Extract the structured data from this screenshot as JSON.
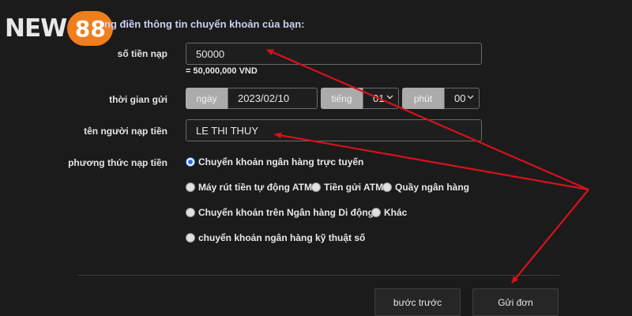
{
  "logo": {
    "part1": "NEW",
    "part2": "88"
  },
  "heading": "ng điền thông tin chuyển khoản của bạn:",
  "amount": {
    "label": "số tiền nạp",
    "value": "50000",
    "converted": "= 50,000,000 VND"
  },
  "time": {
    "label": "thời gian gửi",
    "day_label": "ngày",
    "day_value": "2023/02/10",
    "hour_label": "tiếng",
    "hour_value": "01",
    "minute_label": "phút",
    "minute_value": "00"
  },
  "name": {
    "label": "tên người nạp tiền",
    "value": "LE THI THUY"
  },
  "method": {
    "label": "phương thức nạp tiền",
    "options": [
      "Chuyển khoản ngân hàng trực tuyến",
      "Máy rút tiền tự động ATM",
      "Tiền gửi ATM",
      "Quầy ngân hàng",
      "Chuyển khoản trên Ngân hàng Di động",
      "Khác",
      "chuyển khoản ngân hàng kỹ thuật số"
    ],
    "selected": "Chuyển khoản ngân hàng trực tuyến"
  },
  "buttons": {
    "back": "bước trước",
    "submit": "Gửi đơn"
  },
  "colors": {
    "background": "#1b1b1b",
    "logo_accent": "#f07e1c",
    "arrow": "#d8111b",
    "radio_selected": "#2d6fd6"
  }
}
